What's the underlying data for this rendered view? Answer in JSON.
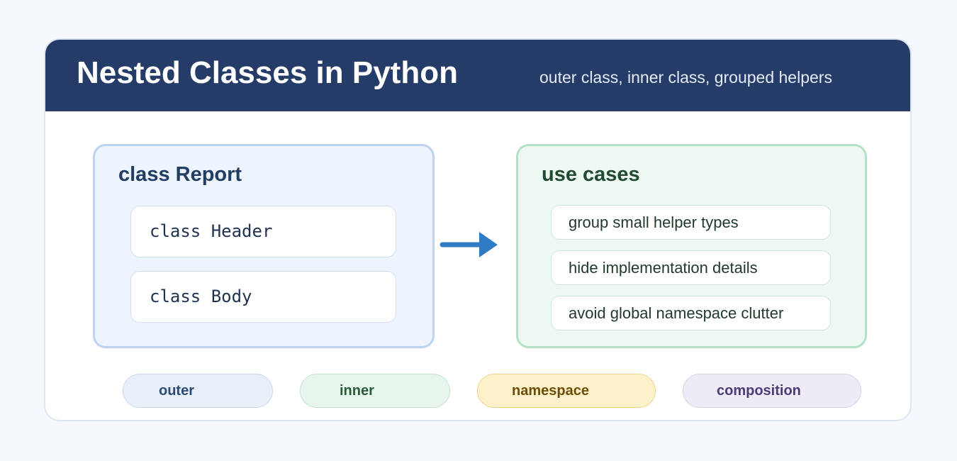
{
  "header": {
    "title": "Nested Classes in Python",
    "subtitle": "outer class, inner class, grouped helpers"
  },
  "outer_panel": {
    "title": "class Report",
    "inner_classes": [
      "class Header",
      "class Body"
    ]
  },
  "arrow": {
    "icon": "right-arrow-icon",
    "color": "#2f7cc4"
  },
  "uses_panel": {
    "title": "use cases",
    "items": [
      "group small helper types",
      "hide implementation details",
      "avoid global namespace clutter"
    ]
  },
  "tags": [
    "outer",
    "inner",
    "namespace",
    "composition"
  ],
  "colors": {
    "header_bg": "#253c68",
    "outer_panel": "#edf4fd",
    "uses_panel": "#eef8f3",
    "arrow": "#2f7cc4"
  }
}
